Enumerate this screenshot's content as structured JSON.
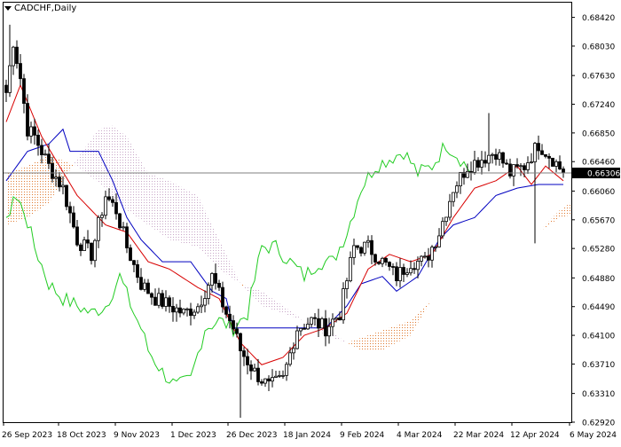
{
  "header": {
    "symbol_label": "CADCHF,Daily",
    "menu_icon": "triangle-down-icon"
  },
  "colors": {
    "background": "#ffffff",
    "frame": "#000000",
    "candle": "#000000",
    "tenkan": "#d80000",
    "kijun": "#0000c0",
    "chikou": "#22cc22",
    "span_a_cloud": "#e07a30",
    "span_b_cloud": "#c8a8c8",
    "current_price_line": "#808080",
    "price_label_bg": "#000000",
    "price_label_text": "#ffffff"
  },
  "chart_data": {
    "type": "candlestick",
    "title": "CADCHF,Daily",
    "indicator": "Ichimoku Kinko Hyo",
    "ylim": [
      0.6292,
      0.6862
    ],
    "y_ticks": [
      "0.68420",
      "0.68030",
      "0.67630",
      "0.67240",
      "0.66850",
      "0.66460",
      "0.66306",
      "0.66060",
      "0.65670",
      "0.65280",
      "0.64880",
      "0.64490",
      "0.64100",
      "0.63710",
      "0.63310",
      "0.62920"
    ],
    "y_tick_values": [
      0.6842,
      0.6803,
      0.6763,
      0.6724,
      0.6685,
      0.6646,
      0.6606,
      0.6567,
      0.6528,
      0.6488,
      0.6449,
      0.641,
      0.6371,
      0.6331,
      0.6292
    ],
    "current_price": "0.66306",
    "current_price_value": 0.66306,
    "x_ticks": [
      "26 Sep 2023",
      "18 Oct 2023",
      "9 Nov 2023",
      "1 Dec 2023",
      "26 Dec 2023",
      "18 Jan 2024",
      "9 Feb 2024",
      "4 Mar 2024",
      "22 Mar 2024",
      "12 Apr 2024",
      "6 May 2024"
    ],
    "bar_count": 158,
    "bar_spacing": 4,
    "future_bars": 8,
    "close_path_anchors": [
      [
        0,
        0.674
      ],
      [
        2,
        0.681
      ],
      [
        4,
        0.676
      ],
      [
        6,
        0.669
      ],
      [
        8,
        0.668
      ],
      [
        12,
        0.664
      ],
      [
        16,
        0.661
      ],
      [
        20,
        0.654
      ],
      [
        24,
        0.652
      ],
      [
        28,
        0.66
      ],
      [
        31,
        0.658
      ],
      [
        34,
        0.653
      ],
      [
        38,
        0.648
      ],
      [
        42,
        0.646
      ],
      [
        46,
        0.645
      ],
      [
        50,
        0.644
      ],
      [
        54,
        0.645
      ],
      [
        58,
        0.649
      ],
      [
        62,
        0.644
      ],
      [
        64,
        0.642
      ],
      [
        66,
        0.639
      ],
      [
        70,
        0.636
      ],
      [
        74,
        0.634
      ],
      [
        78,
        0.635
      ],
      [
        82,
        0.642
      ],
      [
        86,
        0.643
      ],
      [
        90,
        0.642
      ],
      [
        94,
        0.644
      ],
      [
        98,
        0.653
      ],
      [
        102,
        0.653
      ],
      [
        106,
        0.651
      ],
      [
        110,
        0.649
      ],
      [
        114,
        0.651
      ],
      [
        118,
        0.651
      ],
      [
        122,
        0.655
      ],
      [
        126,
        0.661
      ],
      [
        130,
        0.664
      ],
      [
        134,
        0.665
      ],
      [
        138,
        0.666
      ],
      [
        142,
        0.663
      ],
      [
        146,
        0.664
      ],
      [
        150,
        0.667
      ],
      [
        154,
        0.665
      ],
      [
        157,
        0.6631
      ]
    ],
    "high_low_spikes": [
      [
        66,
        0.6298
      ],
      [
        149,
        0.6535
      ],
      [
        136,
        0.6712
      ],
      [
        1,
        0.6832
      ]
    ],
    "tenkan_anchors": [
      [
        0,
        0.67
      ],
      [
        4,
        0.675
      ],
      [
        10,
        0.668
      ],
      [
        20,
        0.66
      ],
      [
        28,
        0.656
      ],
      [
        34,
        0.655
      ],
      [
        40,
        0.651
      ],
      [
        46,
        0.65
      ],
      [
        54,
        0.6475
      ],
      [
        60,
        0.646
      ],
      [
        66,
        0.64
      ],
      [
        72,
        0.637
      ],
      [
        78,
        0.638
      ],
      [
        84,
        0.641
      ],
      [
        90,
        0.642
      ],
      [
        96,
        0.644
      ],
      [
        102,
        0.65
      ],
      [
        108,
        0.652
      ],
      [
        114,
        0.651
      ],
      [
        120,
        0.652
      ],
      [
        126,
        0.657
      ],
      [
        132,
        0.661
      ],
      [
        138,
        0.662
      ],
      [
        144,
        0.664
      ],
      [
        148,
        0.6615
      ],
      [
        152,
        0.664
      ],
      [
        157,
        0.662
      ]
    ],
    "kijun_anchors": [
      [
        0,
        0.662
      ],
      [
        6,
        0.666
      ],
      [
        12,
        0.667
      ],
      [
        16,
        0.669
      ],
      [
        18,
        0.666
      ],
      [
        22,
        0.666
      ],
      [
        26,
        0.666
      ],
      [
        30,
        0.662
      ],
      [
        34,
        0.657
      ],
      [
        38,
        0.654
      ],
      [
        44,
        0.651
      ],
      [
        52,
        0.651
      ],
      [
        58,
        0.647
      ],
      [
        62,
        0.646
      ],
      [
        64,
        0.642
      ],
      [
        72,
        0.642
      ],
      [
        80,
        0.642
      ],
      [
        90,
        0.642
      ],
      [
        96,
        0.645
      ],
      [
        100,
        0.648
      ],
      [
        106,
        0.649
      ],
      [
        110,
        0.647
      ],
      [
        116,
        0.649
      ],
      [
        122,
        0.654
      ],
      [
        126,
        0.656
      ],
      [
        132,
        0.657
      ],
      [
        138,
        0.66
      ],
      [
        144,
        0.661
      ],
      [
        150,
        0.6615
      ],
      [
        157,
        0.6615
      ]
    ],
    "chikou_shift": 26,
    "senkou_a_anchors": [
      [
        0,
        0.663
      ],
      [
        6,
        0.664
      ],
      [
        12,
        0.6655
      ],
      [
        20,
        0.664
      ],
      [
        28,
        0.661
      ],
      [
        34,
        0.658
      ],
      [
        40,
        0.656
      ],
      [
        46,
        0.654
      ],
      [
        54,
        0.653
      ],
      [
        60,
        0.65
      ],
      [
        66,
        0.648
      ],
      [
        72,
        0.645
      ],
      [
        78,
        0.644
      ],
      [
        84,
        0.643
      ],
      [
        90,
        0.641
      ],
      [
        96,
        0.64
      ],
      [
        102,
        0.641
      ],
      [
        108,
        0.642
      ],
      [
        114,
        0.643
      ],
      [
        120,
        0.646
      ],
      [
        126,
        0.648
      ],
      [
        132,
        0.65
      ],
      [
        138,
        0.651
      ],
      [
        144,
        0.653
      ],
      [
        150,
        0.655
      ],
      [
        156,
        0.658
      ],
      [
        162,
        0.66
      ],
      [
        165,
        0.661
      ]
    ],
    "senkou_b_anchors": [
      [
        0,
        0.656
      ],
      [
        6,
        0.657
      ],
      [
        12,
        0.659
      ],
      [
        20,
        0.665
      ],
      [
        26,
        0.669
      ],
      [
        30,
        0.6695
      ],
      [
        34,
        0.668
      ],
      [
        40,
        0.663
      ],
      [
        46,
        0.662
      ],
      [
        54,
        0.66
      ],
      [
        58,
        0.656
      ],
      [
        62,
        0.652
      ],
      [
        66,
        0.648
      ],
      [
        72,
        0.647
      ],
      [
        78,
        0.645
      ],
      [
        84,
        0.643
      ],
      [
        90,
        0.642
      ],
      [
        96,
        0.64
      ],
      [
        100,
        0.639
      ],
      [
        106,
        0.639
      ],
      [
        110,
        0.64
      ],
      [
        114,
        0.641
      ],
      [
        120,
        0.646
      ],
      [
        126,
        0.648
      ],
      [
        132,
        0.65
      ],
      [
        138,
        0.651
      ],
      [
        144,
        0.653
      ],
      [
        150,
        0.655
      ],
      [
        156,
        0.657
      ],
      [
        165,
        0.658
      ]
    ]
  }
}
